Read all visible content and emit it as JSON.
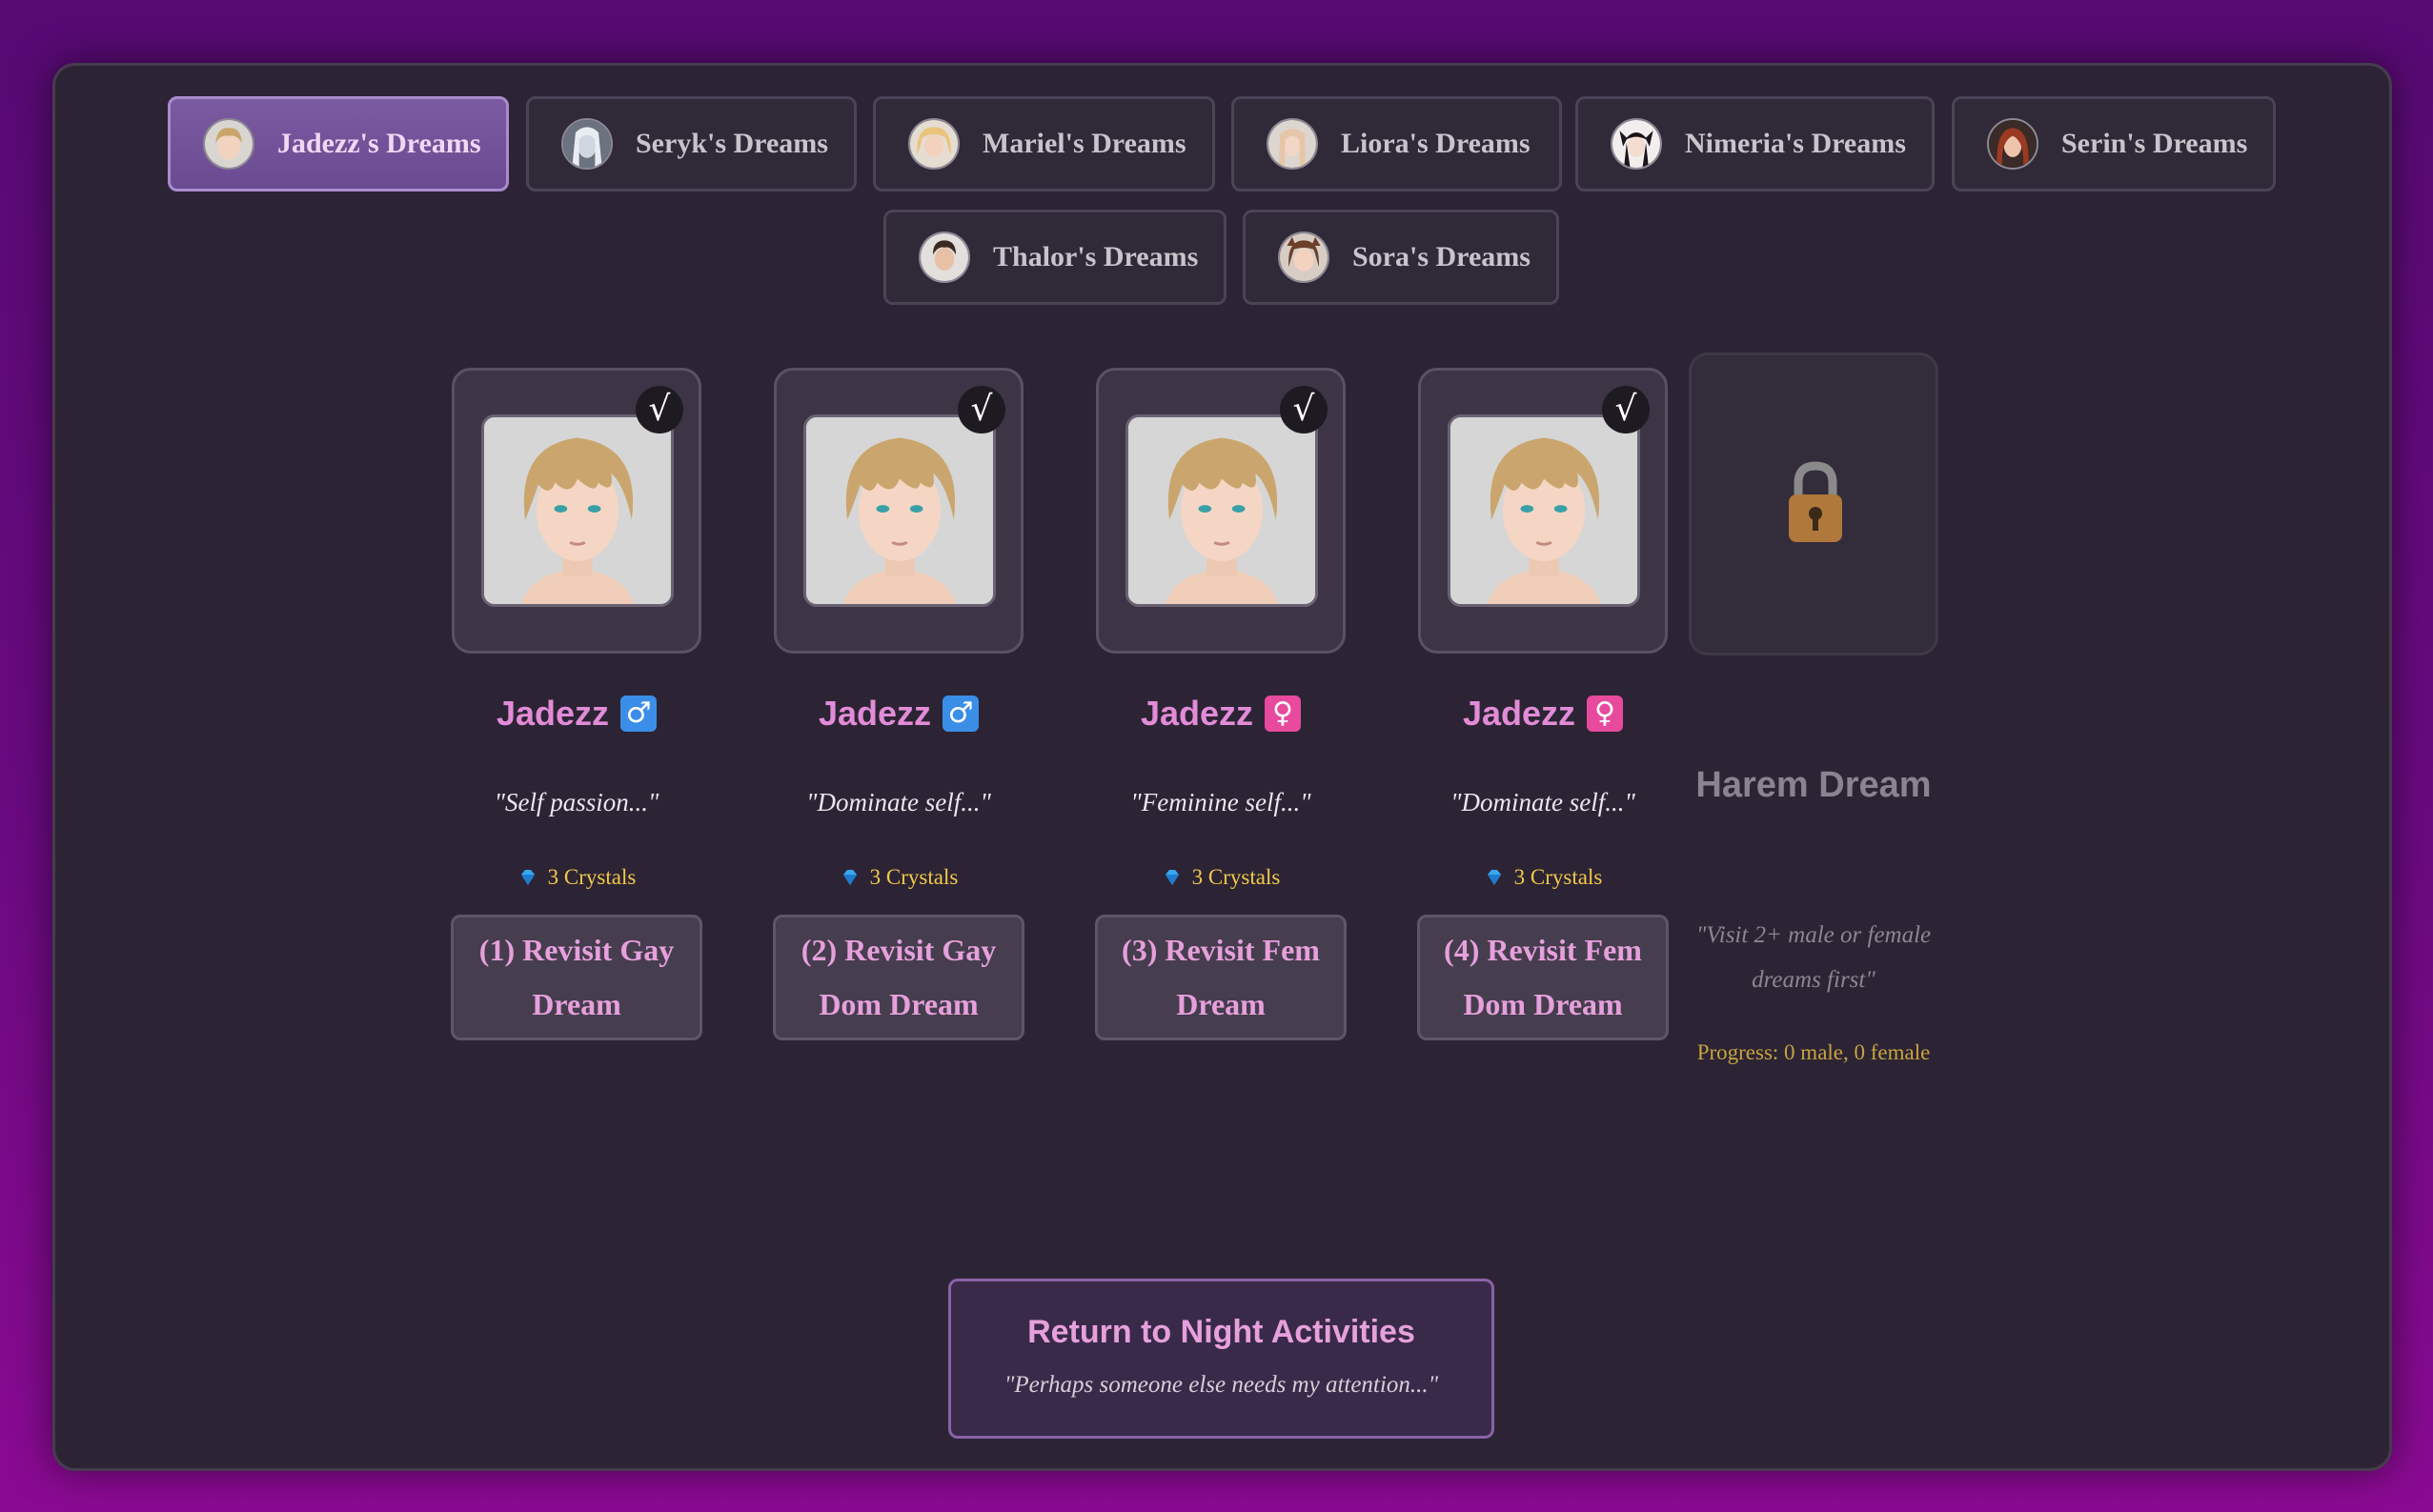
{
  "tabs": [
    {
      "label": "Jadezz's Dreams",
      "active": true
    },
    {
      "label": "Seryk's Dreams"
    },
    {
      "label": "Mariel's Dreams"
    },
    {
      "label": "Liora's Dreams"
    },
    {
      "label": "Nimeria's Dreams"
    },
    {
      "label": "Serin's Dreams"
    },
    {
      "label": "Thalor's Dreams"
    },
    {
      "label": "Sora's Dreams"
    }
  ],
  "cards": [
    {
      "name": "Jadezz",
      "gender": "♂",
      "gender_color": "#3a8ee8",
      "quote": "\"Self passion...\"",
      "cost": "3 Crystals",
      "button": "(1) Revisit Gay Dream"
    },
    {
      "name": "Jadezz",
      "gender": "♂",
      "gender_color": "#3a8ee8",
      "quote": "\"Dominate self...\"",
      "cost": "3 Crystals",
      "button": "(2) Revisit Gay Dom Dream"
    },
    {
      "name": "Jadezz",
      "gender": "♀",
      "gender_color": "#e84a9e",
      "quote": "\"Feminine self...\"",
      "cost": "3 Crystals",
      "button": "(3) Revisit Fem Dream"
    },
    {
      "name": "Jadezz",
      "gender": "♀",
      "gender_color": "#e84a9e",
      "quote": "\"Dominate self...\"",
      "cost": "3 Crystals",
      "button": "(4) Revisit Fem Dom Dream"
    }
  ],
  "check_mark": "√",
  "locked": {
    "title": "Harem Dream",
    "hint": "\"Visit 2+ male or female dreams first\"",
    "progress": "Progress: 0 male, 0 female"
  },
  "return_button": {
    "title": "Return to Night Activities",
    "subtitle": "\"Perhaps someone else needs my attention...\""
  },
  "colors": {
    "accent_pink": "#e28bd8",
    "crystal_gold": "#f2c94a",
    "active_tab": "#7a5aa0"
  }
}
